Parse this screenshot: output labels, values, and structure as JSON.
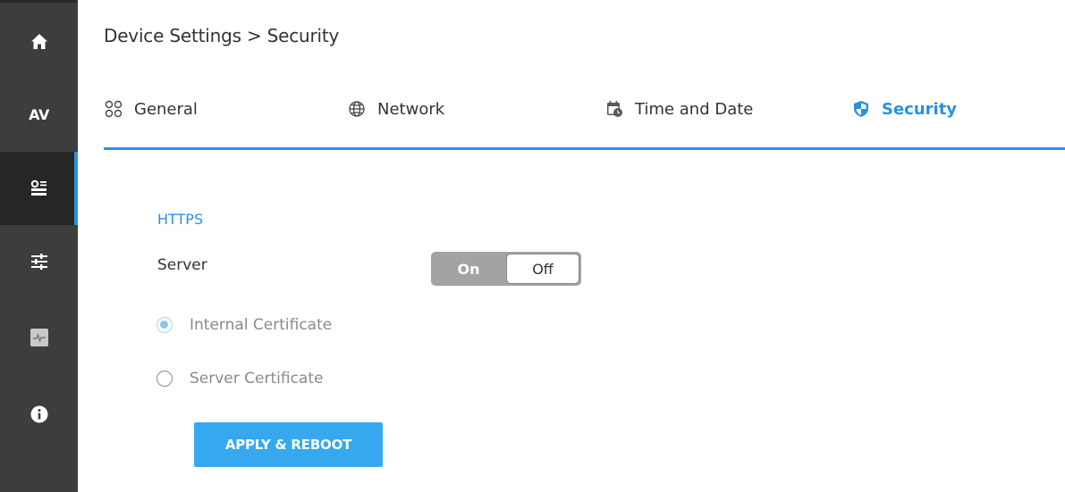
{
  "sidebar": {
    "items": [
      {
        "icon": "home-icon"
      },
      {
        "icon": "av-icon",
        "label": "AV"
      },
      {
        "icon": "device-settings-icon",
        "active": true
      },
      {
        "icon": "sliders-icon"
      },
      {
        "icon": "diagnostics-icon"
      },
      {
        "icon": "info-icon"
      }
    ]
  },
  "breadcrumb": "Device Settings > Security",
  "tabs": [
    {
      "label": "General",
      "icon": "general-icon",
      "active": false
    },
    {
      "label": "Network",
      "icon": "network-icon",
      "active": false
    },
    {
      "label": "Time and Date",
      "icon": "calendar-clock-icon",
      "active": false
    },
    {
      "label": "Security",
      "icon": "shield-icon",
      "active": true
    }
  ],
  "https": {
    "title": "HTTPS",
    "server_label": "Server",
    "toggle": {
      "on_label": "On",
      "off_label": "Off",
      "selected": "Off"
    },
    "options": [
      {
        "label": "Internal Certificate",
        "checked": true
      },
      {
        "label": "Server Certificate",
        "checked": false
      }
    ],
    "apply_label": "APPLY & REBOOT"
  },
  "colors": {
    "accent": "#2d8fe0",
    "button": "#35a8f0",
    "sidebar": "#3d3d3d",
    "sidebar_active": "#262626"
  }
}
